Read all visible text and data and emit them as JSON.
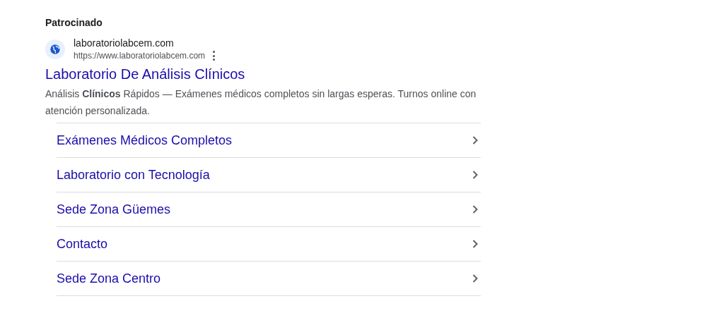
{
  "label": "Patrocinado",
  "ad": {
    "site_name": "laboratoriolabcem.com",
    "url": "https://www.laboratoriolabcem.com",
    "title": "Laboratorio De Análisis Clínicos",
    "description": "Análisis **Clínicos** Rápidos — Exámenes médicos completos sin largas esperas. Turnos online con atención personalizada."
  },
  "sitelinks": [
    {
      "label": "Exámenes Médicos Completos"
    },
    {
      "label": "Laboratorio con Tecnología"
    },
    {
      "label": "Sede Zona Güemes"
    },
    {
      "label": "Contacto"
    },
    {
      "label": "Sede Zona Centro"
    }
  ]
}
